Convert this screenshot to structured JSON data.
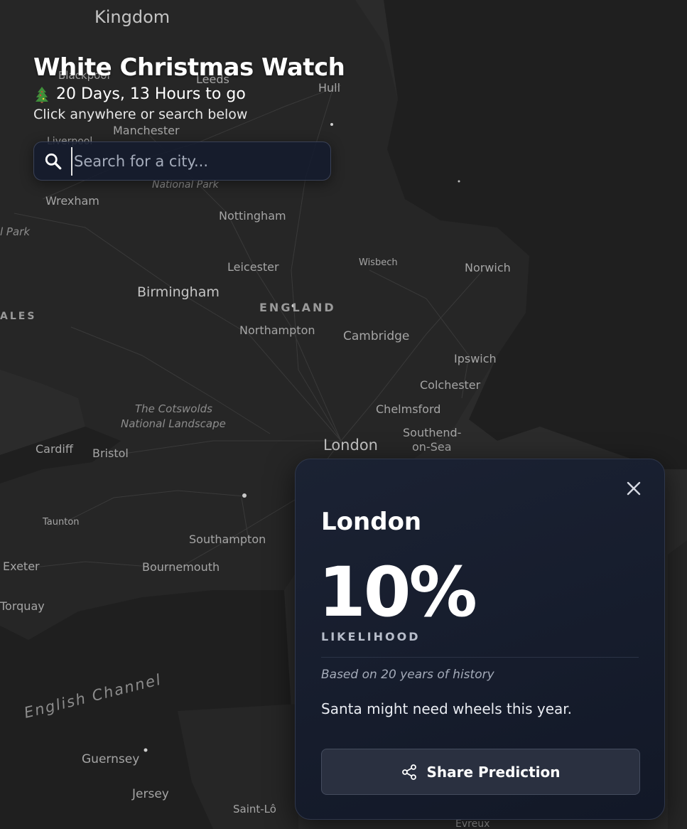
{
  "app": {
    "title": "White Christmas Watch",
    "countdown": "20 Days, 13 Hours to go",
    "hint": "Click anywhere or search below"
  },
  "search": {
    "placeholder": "Search for a city...",
    "value": "",
    "icon": "search-icon"
  },
  "map": {
    "labels": {
      "kingdom": "Kingdom",
      "leeds": "Leeds",
      "hull": "Hull",
      "blackpool": "Blackpool",
      "manchester": "Manchester",
      "liverpool": "Liverpool",
      "national_park": "National Park",
      "wrexham": "Wrexham",
      "nottingham": "Nottingham",
      "l_park": "l Park",
      "leicester": "Leicester",
      "wisbech": "Wisbech",
      "norwich": "Norwich",
      "birmingham": "Birmingham",
      "ales": "ALES",
      "england": "ENGLAND",
      "northampton": "Northampton",
      "cambridge": "Cambridge",
      "ipswich": "Ipswich",
      "colchester": "Colchester",
      "cotswolds_1": "The Cotswolds",
      "cotswolds_2": "National Landscape",
      "chelmsford": "Chelmsford",
      "southend_1": "Southend-",
      "southend_2": "on-Sea",
      "cardiff": "Cardiff",
      "bristol": "Bristol",
      "london": "London",
      "taunton": "Taunton",
      "southampton": "Southampton",
      "exeter": "Exeter",
      "bournemouth": "Bournemouth",
      "torquay": "Torquay",
      "english_channel": "English Channel",
      "guernsey": "Guernsey",
      "jersey": "Jersey",
      "saint_lo": "Saint-Lô",
      "evreux": "Evreux"
    }
  },
  "card": {
    "city": "London",
    "percentage": "10%",
    "likelihood_label": "LIKELIHOOD",
    "history_note": "Based on 20 years of history",
    "message": "Santa might need wheels this year.",
    "share_label": "Share Prediction",
    "close_icon": "close-icon",
    "share_icon": "share-icon"
  },
  "colors": {
    "background": "#262626",
    "card": "#161c2b",
    "button": "#2a3040"
  }
}
